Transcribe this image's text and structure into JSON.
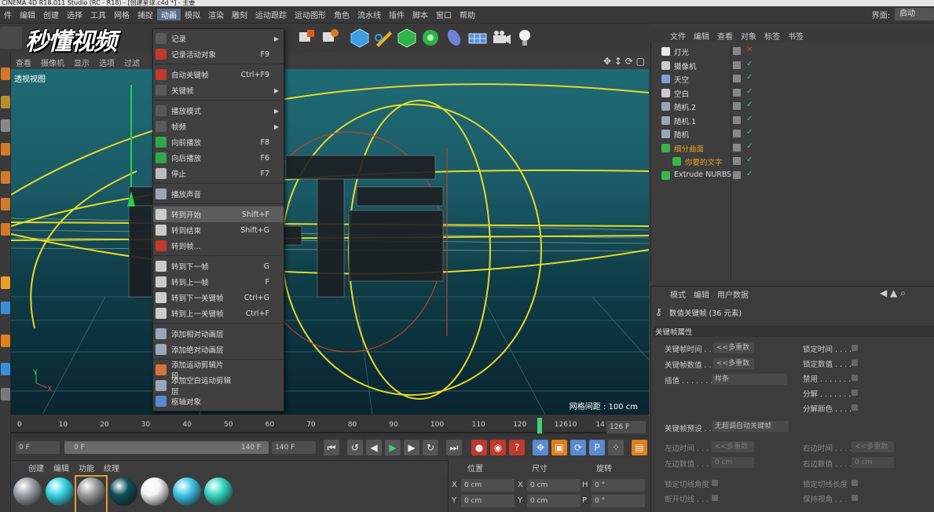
{
  "title": "CINEMA 4D R18.011 Studio (RC - R18) - [创建星球.c4d *] - 主要",
  "menubar": [
    "件",
    "编辑",
    "创建",
    "选择",
    "工具",
    "网格",
    "捕捉",
    "动画",
    "模拟",
    "渲染",
    "雕刻",
    "运动跟踪",
    "运动图形",
    "角色",
    "流水线",
    "插件",
    "脚本",
    "窗口",
    "帮助"
  ],
  "active_menu": "动画",
  "layout_label": "界面:",
  "layout_value": "启动",
  "watermark": "秒懂视频",
  "viewport": {
    "menu": [
      "查看",
      "摄像机",
      "显示",
      "选项",
      "过滤"
    ],
    "label": "透视视图",
    "grid": "网格间距 : 100 cm"
  },
  "menu": {
    "items": [
      {
        "label": "记录",
        "shortcut": "",
        "arrow": true,
        "color": "#5a5a5a"
      },
      {
        "label": "记录活动对象",
        "shortcut": "F9",
        "arrow": false,
        "color": "#c0392b"
      },
      {
        "label": "自动关键帧",
        "shortcut": "Ctrl+F9",
        "arrow": false,
        "color": "#c0392b"
      },
      {
        "label": "关键帧",
        "shortcut": "",
        "arrow": true,
        "color": "#5a5a5a"
      },
      {
        "label": "播放模式",
        "shortcut": "",
        "arrow": true,
        "color": "#5a5a5a"
      },
      {
        "label": "帧频",
        "shortcut": "",
        "arrow": true,
        "color": "#5a5a5a"
      },
      {
        "label": "向前播放",
        "shortcut": "F8",
        "arrow": false,
        "color": "#2ea84a"
      },
      {
        "label": "向后播放",
        "shortcut": "F6",
        "arrow": false,
        "color": "#2ea84a"
      },
      {
        "label": "停止",
        "shortcut": "F7",
        "arrow": false,
        "color": "#bbbbbb"
      },
      {
        "label": "播放声音",
        "shortcut": "",
        "arrow": false,
        "color": "#9aa7b8"
      },
      {
        "label": "转到开始",
        "shortcut": "Shift+F",
        "arrow": false,
        "color": "#cccccc"
      },
      {
        "label": "转到结束",
        "shortcut": "Shift+G",
        "arrow": false,
        "color": "#cccccc"
      },
      {
        "label": "转到帧...",
        "shortcut": "",
        "arrow": false,
        "color": "#c0392b"
      },
      {
        "label": "转到下一帧",
        "shortcut": "G",
        "arrow": false,
        "color": "#cccccc"
      },
      {
        "label": "转到上一帧",
        "shortcut": "F",
        "arrow": false,
        "color": "#cccccc"
      },
      {
        "label": "转到下一关键帧",
        "shortcut": "Ctrl+G",
        "arrow": false,
        "color": "#cccccc"
      },
      {
        "label": "转到上一关键帧",
        "shortcut": "Ctrl+F",
        "arrow": false,
        "color": "#cccccc"
      },
      {
        "label": "添加相对动画层",
        "shortcut": "",
        "arrow": false,
        "color": "#9aa7b8"
      },
      {
        "label": "添加绝对动画层",
        "shortcut": "",
        "arrow": false,
        "color": "#9aa7b8"
      },
      {
        "label": "添加运动剪辑片段...",
        "shortcut": "",
        "arrow": false,
        "color": "#d3763a"
      },
      {
        "label": "添加空白运动剪辑层",
        "shortcut": "",
        "arrow": false,
        "color": "#9aa7b8"
      },
      {
        "label": "枢轴对象",
        "shortcut": "",
        "arrow": false,
        "color": "#5a8ad0"
      }
    ]
  },
  "timeline": {
    "ticks": [
      "0",
      "10",
      "20",
      "30",
      "40",
      "50",
      "60",
      "70",
      "80",
      "90",
      "100",
      "110",
      "120",
      "12610",
      "14"
    ],
    "current_frame_field": "126 F"
  },
  "playbar": {
    "start": "0 F",
    "slider_start": "0 F",
    "slider_end": "140 F",
    "end": "140 F"
  },
  "materials": {
    "menu": [
      "创建",
      "编辑",
      "功能",
      "纹理"
    ],
    "balls": [
      {
        "color": "#9aa0a8",
        "label": ""
      },
      {
        "color": "#36d6e6",
        "label": ""
      },
      {
        "color": "#9b9b9b",
        "label": ""
      },
      {
        "color": "#0f4f5a",
        "label": ""
      },
      {
        "color": "#f2f2f2",
        "label": ""
      },
      {
        "color": "#3fc7e8",
        "label": ""
      },
      {
        "color": "#36d9c4",
        "label": ""
      }
    ]
  },
  "coords": {
    "headers": [
      "位置",
      "尺寸",
      "旋转"
    ],
    "rows": [
      {
        "a": "X",
        "av": "0 cm",
        "b": "X",
        "bv": "0 cm",
        "c": "H",
        "cv": "0 °"
      },
      {
        "a": "Y",
        "av": "0 cm",
        "b": "Y",
        "bv": "0 cm",
        "c": "P",
        "cv": "0 °"
      }
    ]
  },
  "objects": {
    "menu": [
      "文件",
      "编辑",
      "查看",
      "对象",
      "标签",
      "书签"
    ],
    "rows": [
      {
        "name": "灯光",
        "indent": 0,
        "color": "#e8e8e8",
        "name_color": "#dddddd"
      },
      {
        "name": "摄像机",
        "indent": 0,
        "color": "#cccccc",
        "name_color": "#dddddd"
      },
      {
        "name": "天空",
        "indent": 0,
        "color": "#7aa0d8",
        "name_color": "#dddddd"
      },
      {
        "name": "空白",
        "indent": 0,
        "color": "#cccccc",
        "name_color": "#dddddd"
      },
      {
        "name": "随机.2",
        "indent": 0,
        "color": "#9aa7b8",
        "name_color": "#dddddd"
      },
      {
        "name": "随机.1",
        "indent": 0,
        "color": "#9aa7b8",
        "name_color": "#dddddd"
      },
      {
        "name": "随机",
        "indent": 0,
        "color": "#9aa7b8",
        "name_color": "#dddddd"
      },
      {
        "name": "细分曲面",
        "indent": 0,
        "color": "#3bb54a",
        "name_color": "#e4a22a"
      },
      {
        "name": "你要的文字",
        "indent": 1,
        "color": "#3bb54a",
        "name_color": "#e4a22a"
      },
      {
        "name": "Extrude NURBS",
        "indent": 0,
        "color": "#3bb54a",
        "name_color": "#dddddd"
      }
    ]
  },
  "attributes": {
    "menu": [
      "模式",
      "编辑",
      "用户数据"
    ],
    "title": "数值关键帧 (36 元素)",
    "section": "关键帧属性",
    "fields_left": [
      {
        "label": "关键帧时间 . .",
        "value": "<<多重数"
      },
      {
        "label": "关键帧数值 . .",
        "value": "<<多重数"
      },
      {
        "label": "插值 . . . . . . . .",
        "value": "样条"
      }
    ],
    "fields_right": [
      "锁定时间 . . . .",
      "锁定数值 . . . .",
      "禁用 . . . . . . .",
      "分解 . . . . . . .",
      "分解颜色 . . . ."
    ],
    "preset_label": "关键帧预设 . .",
    "preset_value": "无超调自动关键帧",
    "tangent_left": [
      {
        "label": "左边时间 . . . .",
        "value": "<<多重数"
      },
      {
        "label": "左边数值 . . . .",
        "value": "0 cm"
      }
    ],
    "tangent_right": [
      {
        "label": "右边时间 . . . .",
        "value": "<<多重数"
      },
      {
        "label": "右边数值 . . . .",
        "value": "0 cm"
      }
    ],
    "bottom_left": [
      "锁定切线角度",
      "断开切线 . . ."
    ],
    "bottom_right": [
      "锁定切线长度",
      "保持视角 . . ."
    ]
  }
}
